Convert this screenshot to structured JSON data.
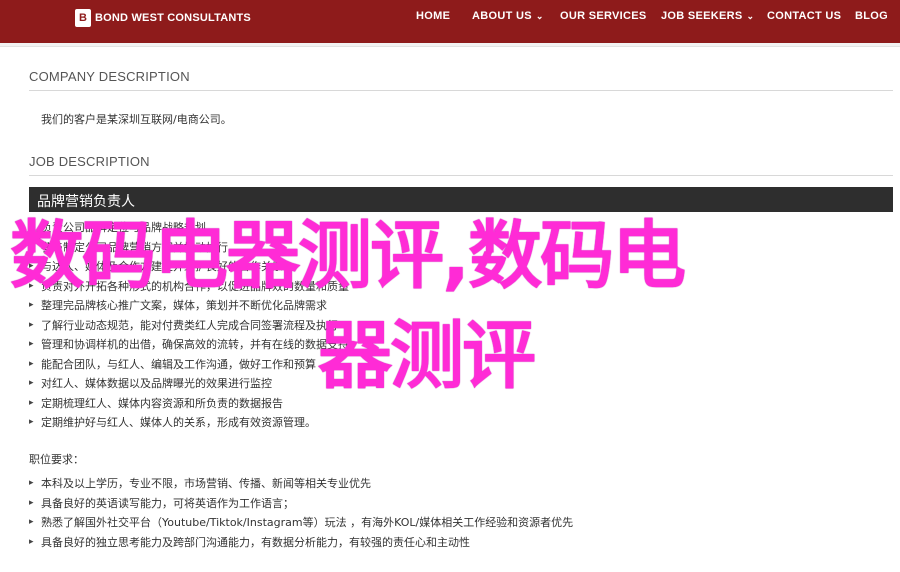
{
  "header": {
    "logo_mark": "B",
    "logo_text": "BOND WEST CONSULTANTS",
    "nav": [
      {
        "label": "HOME",
        "dropdown": false
      },
      {
        "label": "ABOUT US",
        "dropdown": true
      },
      {
        "label": "OUR SERVICES",
        "dropdown": false
      },
      {
        "label": "JOB SEEKERS",
        "dropdown": true
      },
      {
        "label": "CONTACT US",
        "dropdown": false
      },
      {
        "label": "BLOG",
        "dropdown": false
      }
    ],
    "chevron": "⌄"
  },
  "company": {
    "title": "COMPANY DESCRIPTION",
    "text": "我们的客户是某深圳互联网/电商公司。"
  },
  "job": {
    "title": "JOB DESCRIPTION",
    "role": "品牌营销负责人",
    "duties": [
      "负责公司品牌定位与品牌战略规划",
      "参与制定公司品牌营销方案并推动执行",
      "与达人、媒体及合作方建立并维护良好的合作关系",
      "负责对外开拓各种形式的机构合作，以促进品牌效的数量和质量",
      "整理完品牌核心推广文案，媒体，策划并不断优化品牌需求",
      "了解行业动态规范，能对付费类红人完成合同签署流程及执行",
      "管理和协调样机的出借，确保高效的流转，并有在线的数据支持",
      "能配合团队，与红人、编辑及工作沟通，做好工作和预算",
      "对红人、媒体数据以及品牌曝光的效果进行监控",
      "定期梳理红人、媒体内容资源和所负责的数据报告",
      "定期维护好与红人、媒体人的关系，形成有效资源管理。"
    ],
    "bullet": "▸",
    "requirements_label": "职位要求：",
    "requirements": [
      "本科及以上学历，专业不限，市场营销、传播、新闻等相关专业优先",
      "具备良好的英语读写能力，可将英语作为工作语言；",
      "熟悉了解国外社交平台（Youtube/Tiktok/Instagram等）玩法 ，有海外KOL/媒体相关工作经验和资源者优先",
      "具备良好的独立思考能力及跨部门沟通能力，有数据分析能力，有较强的责任心和主动性"
    ]
  },
  "overlay": {
    "line1": "数码电器测评,数码电",
    "line2": "器测评",
    "color": "#ff2bd6"
  }
}
